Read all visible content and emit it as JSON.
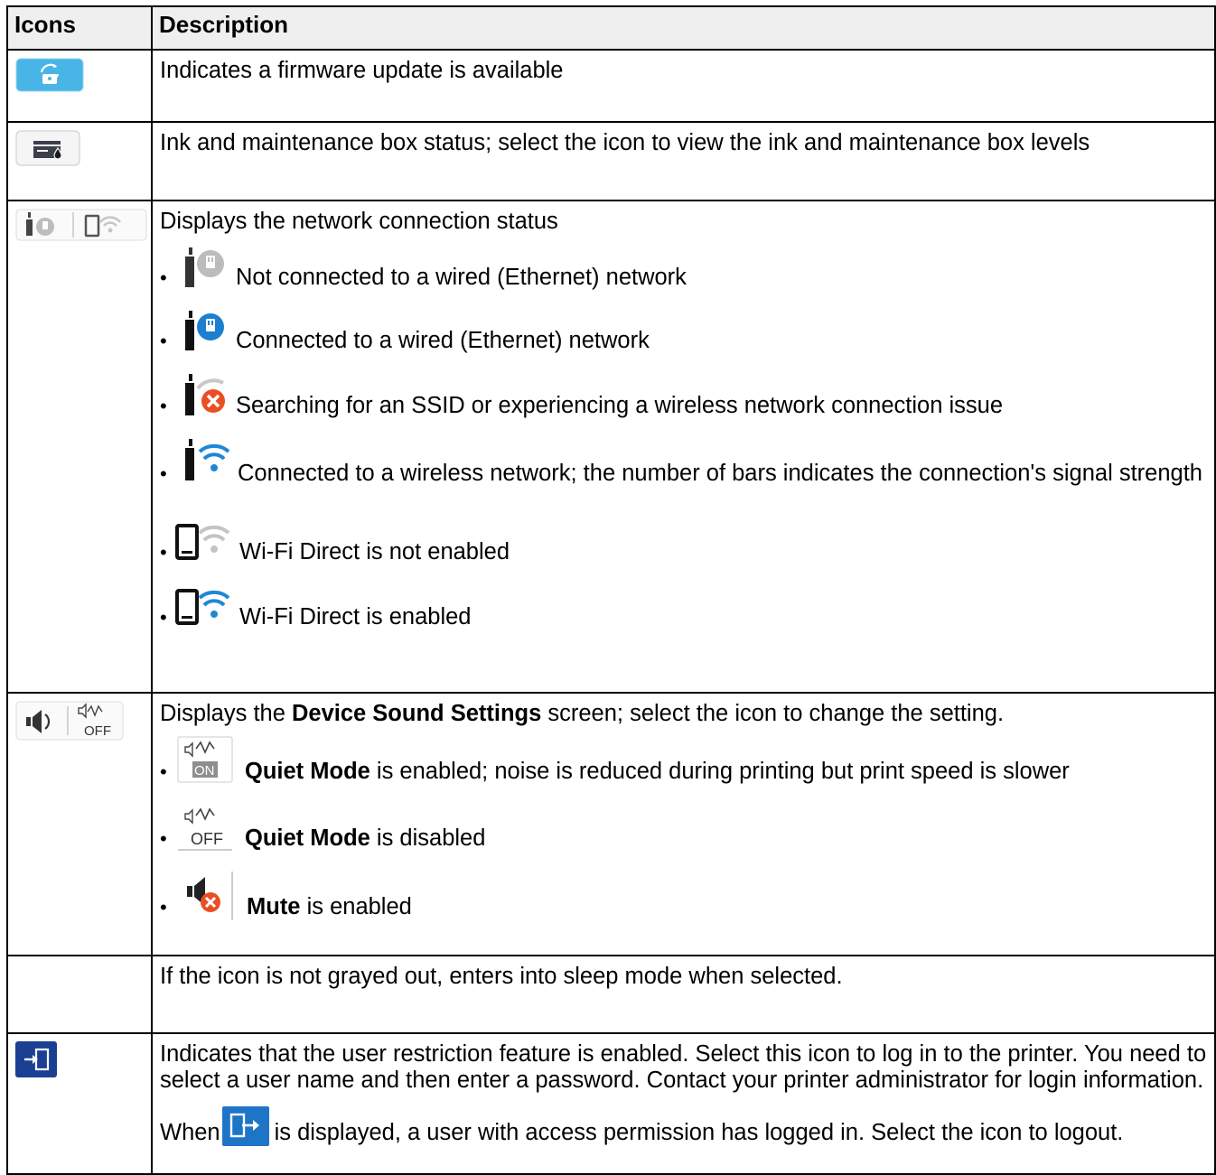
{
  "header": {
    "col_icons": "Icons",
    "col_description": "Description"
  },
  "rows": {
    "firmware": {
      "icon": "firmware-update-icon",
      "text": "Indicates a firmware update is available"
    },
    "ink": {
      "icon": "ink-maintenance-box-icon",
      "text": "Ink and maintenance box status; select the icon to view the ink and maintenance box levels"
    },
    "network": {
      "icon": "network-status-icons",
      "intro": "Displays the network connection status",
      "items": [
        {
          "icon": "ethernet-not-connected-icon",
          "text": "Not connected to a wired (Ethernet) network"
        },
        {
          "icon": "ethernet-connected-icon",
          "text": "Connected to a wired (Ethernet) network"
        },
        {
          "icon": "wireless-error-icon",
          "text": "Searching for an SSID or experiencing a wireless network connection issue"
        },
        {
          "icon": "wireless-connected-icon",
          "text": "Connected to a wireless network; the number of bars indicates the connection's signal strength"
        },
        {
          "icon": "wifi-direct-disabled-icon",
          "text": "Wi-Fi Direct is not enabled"
        },
        {
          "icon": "wifi-direct-enabled-icon",
          "text": "Wi-Fi Direct is enabled"
        }
      ]
    },
    "sound": {
      "icon": "device-sound-icons",
      "intro_pre": "Displays the ",
      "intro_bold": "Device Sound Settings",
      "intro_post": " screen; select the icon to change the setting.",
      "items": [
        {
          "icon": "quiet-mode-on-icon",
          "bold": "Quiet Mode",
          "text": " is enabled; noise is reduced during printing but print speed is slower"
        },
        {
          "icon": "quiet-mode-off-icon",
          "bold": "Quiet Mode",
          "text": " is disabled"
        },
        {
          "icon": "mute-icon",
          "bold": "Mute",
          "text": " is enabled"
        }
      ]
    },
    "sleep": {
      "icon": "moon-icon",
      "text": "If the icon is not grayed out, enters into sleep mode when selected."
    },
    "login": {
      "icon": "login-icon",
      "p1": "Indicates that the user restriction feature is enabled. Select this icon to log in to the printer. You need to select a user name and then enter a password. Contact your printer administrator for login information.",
      "p2_pre": "When",
      "p2_post": "is displayed, a user with access permission has logged in. Select the icon to logout."
    }
  },
  "bullet_char": "•",
  "colors": {
    "accent_blue": "#1e87d6",
    "firmware_bg": "#49b5e6",
    "login_bg": "#1b3f93",
    "error_orange": "#ea4f24",
    "header_bg": "#efefef"
  }
}
